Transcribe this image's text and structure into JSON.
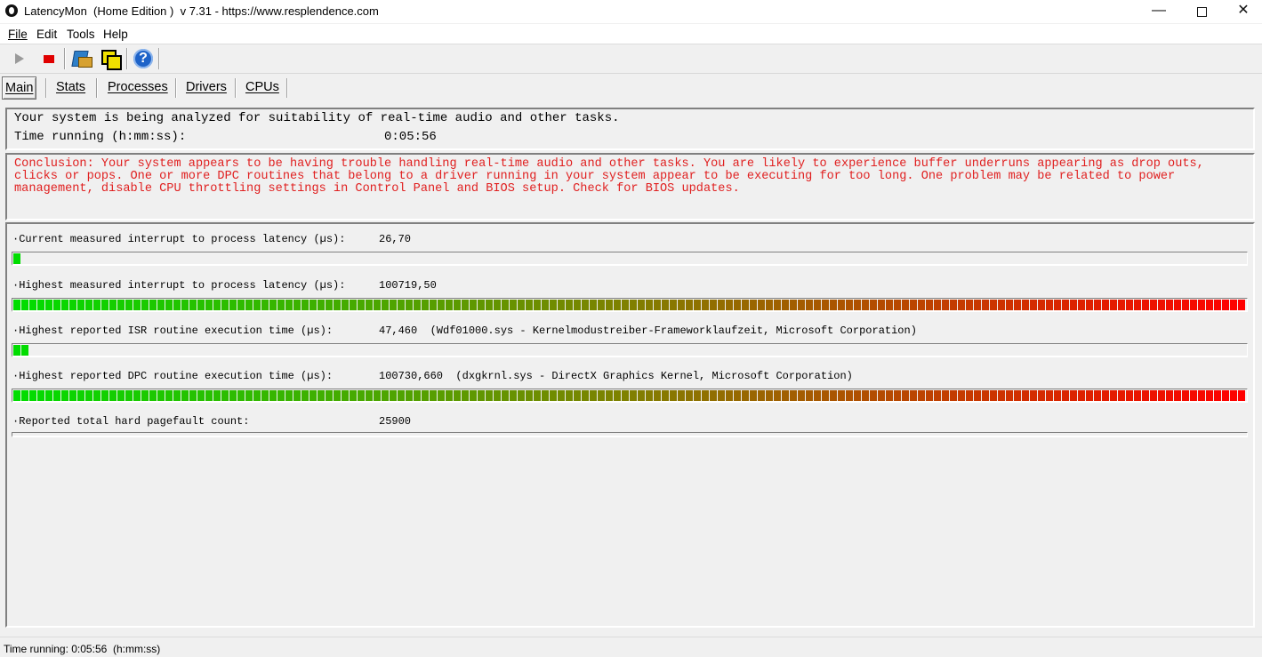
{
  "window": {
    "title": "LatencyMon  (Home Edition )  v 7.31 - https://www.resplendence.com"
  },
  "menu": [
    "File",
    "Edit",
    "Tools",
    "Help"
  ],
  "tabs": [
    "Main",
    "Stats",
    "Processes",
    "Drivers",
    "CPUs"
  ],
  "status": {
    "line1": "Your system is being analyzed for suitability of real-time audio and other tasks.",
    "time_label": "Time running (h:mm:ss):",
    "time_value": "0:05:56"
  },
  "conclusion": "Conclusion: Your system appears to be having trouble handling real-time audio and other tasks. You are likely to experience buffer underruns appearing as drop outs, clicks or pops. One or more DPC routines that belong to a driver running in your system appear to be executing for too long. One problem may be related to power management, disable CPU throttling settings in Control Panel and BIOS setup. Check for BIOS updates.",
  "metrics": [
    {
      "label": "·Current measured interrupt to process latency (µs):",
      "value": "26,70",
      "bar_fraction": 0.007
    },
    {
      "label": "·Highest measured interrupt to process latency (µs):",
      "value": "100719,50",
      "bar_fraction": 1.0
    },
    {
      "label": "·Highest reported ISR routine execution time (µs):",
      "value": "47,460  (Wdf01000.sys - Kernelmodustreiber-Frameworklaufzeit, Microsoft Corporation)",
      "bar_fraction": 0.014
    },
    {
      "label": "·Highest reported DPC routine execution time (µs):",
      "value": "100730,660  (dxgkrnl.sys - DirectX Graphics Kernel, Microsoft Corporation)",
      "bar_fraction": 1.0
    },
    {
      "label": "·Reported total hard pagefault count:",
      "value": "25900",
      "bar_fraction": 0
    }
  ],
  "statusbar": "Time running: 0:05:56  (h:mm:ss)",
  "colors": {
    "bar_low": "#00dd00",
    "bar_mid": "#808000",
    "bar_high": "#ff0000",
    "conclusion": "#e02020"
  },
  "icons": [
    "start-icon",
    "stop-icon",
    "tool-icon",
    "copy-icon",
    "help-icon"
  ]
}
